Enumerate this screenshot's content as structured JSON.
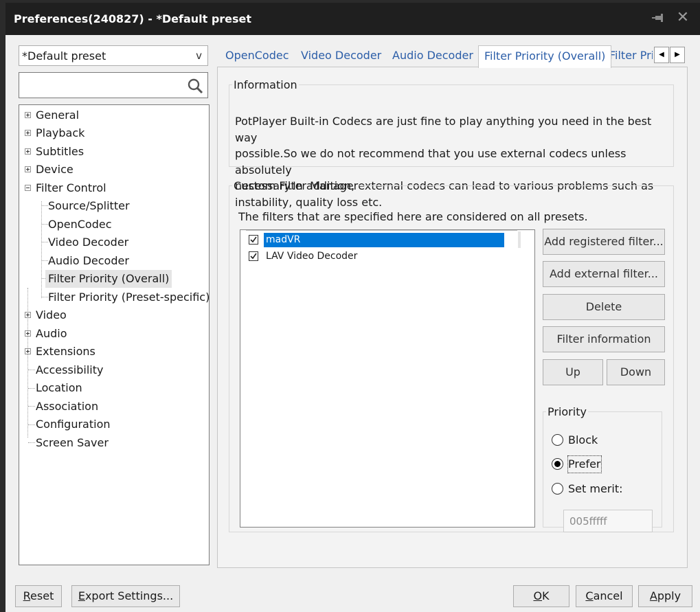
{
  "window": {
    "title": "Preferences(240827) - *Default preset",
    "pin_icon": "pin-icon",
    "close_glyph": "✕"
  },
  "sidebar": {
    "preset_select": {
      "value": "*Default preset",
      "chevron": "v"
    },
    "search": {
      "value": "",
      "placeholder": ""
    },
    "tree": [
      {
        "label": "General",
        "expander": "plus"
      },
      {
        "label": "Playback",
        "expander": "plus"
      },
      {
        "label": "Subtitles",
        "expander": "plus"
      },
      {
        "label": "Device",
        "expander": "plus"
      },
      {
        "label": "Filter Control",
        "expander": "minus"
      },
      {
        "label": "Source/Splitter"
      },
      {
        "label": "OpenCodec"
      },
      {
        "label": "Video Decoder"
      },
      {
        "label": "Audio Decoder"
      },
      {
        "label": "Filter Priority (Overall)",
        "selected": true
      },
      {
        "label": "Filter Priority (Preset-specific)"
      },
      {
        "label": "Video",
        "expander": "plus"
      },
      {
        "label": "Audio",
        "expander": "plus"
      },
      {
        "label": "Extensions",
        "expander": "plus"
      },
      {
        "label": "Accessibility"
      },
      {
        "label": "Location"
      },
      {
        "label": "Association"
      },
      {
        "label": "Configuration"
      },
      {
        "label": "Screen Saver"
      }
    ]
  },
  "tabs": [
    {
      "label": "OpenCodec"
    },
    {
      "label": "Video Decoder"
    },
    {
      "label": "Audio Decoder"
    },
    {
      "label": "Filter Priority (Overall)",
      "active": true
    },
    {
      "label": "Filter Pri"
    }
  ],
  "tab_scroll": {
    "left": "◀",
    "right": "▶"
  },
  "information": {
    "legend": "Information",
    "lines": [
      "PotPlayer Built-in Codecs are just fine to play anything you need in the best way",
      "possible.So we do not recommend that you use external codecs unless absolutely",
      "necessary.In addition, external codecs can lead to various problems such as",
      "instability, quality loss etc."
    ]
  },
  "custom_filter_manager": {
    "legend": "Custom Filter Manager",
    "description": "The filters that are specified here are considered on all presets.",
    "filters": [
      {
        "name": "madVR",
        "checked": true,
        "selected": true
      },
      {
        "name": "LAV Video Decoder",
        "checked": true,
        "selected": false
      }
    ],
    "buttons": {
      "add_registered": "Add registered filter...",
      "add_external": "Add external filter...",
      "delete": "Delete",
      "filter_information": "Filter information",
      "up": "Up",
      "down": "Down"
    },
    "priority": {
      "legend": "Priority",
      "options": [
        {
          "label": "Block",
          "selected": false
        },
        {
          "label": "Prefer",
          "selected": true
        },
        {
          "label": "Set merit:",
          "selected": false
        }
      ],
      "merit_value": "005fffff"
    }
  },
  "footer": {
    "reset": {
      "mnemonic": "R",
      "rest": "eset"
    },
    "export": {
      "mnemonic": "E",
      "rest": "xport Settings..."
    },
    "ok": {
      "mnemonic": "O",
      "rest": "K"
    },
    "cancel": {
      "mnemonic": "C",
      "rest": "ancel"
    },
    "apply": {
      "mnemonic": "A",
      "rest": "pply"
    }
  },
  "colors": {
    "titlebar": "#1f1f1f",
    "tab_text": "#2c5ea8",
    "selection": "#0078d7"
  }
}
